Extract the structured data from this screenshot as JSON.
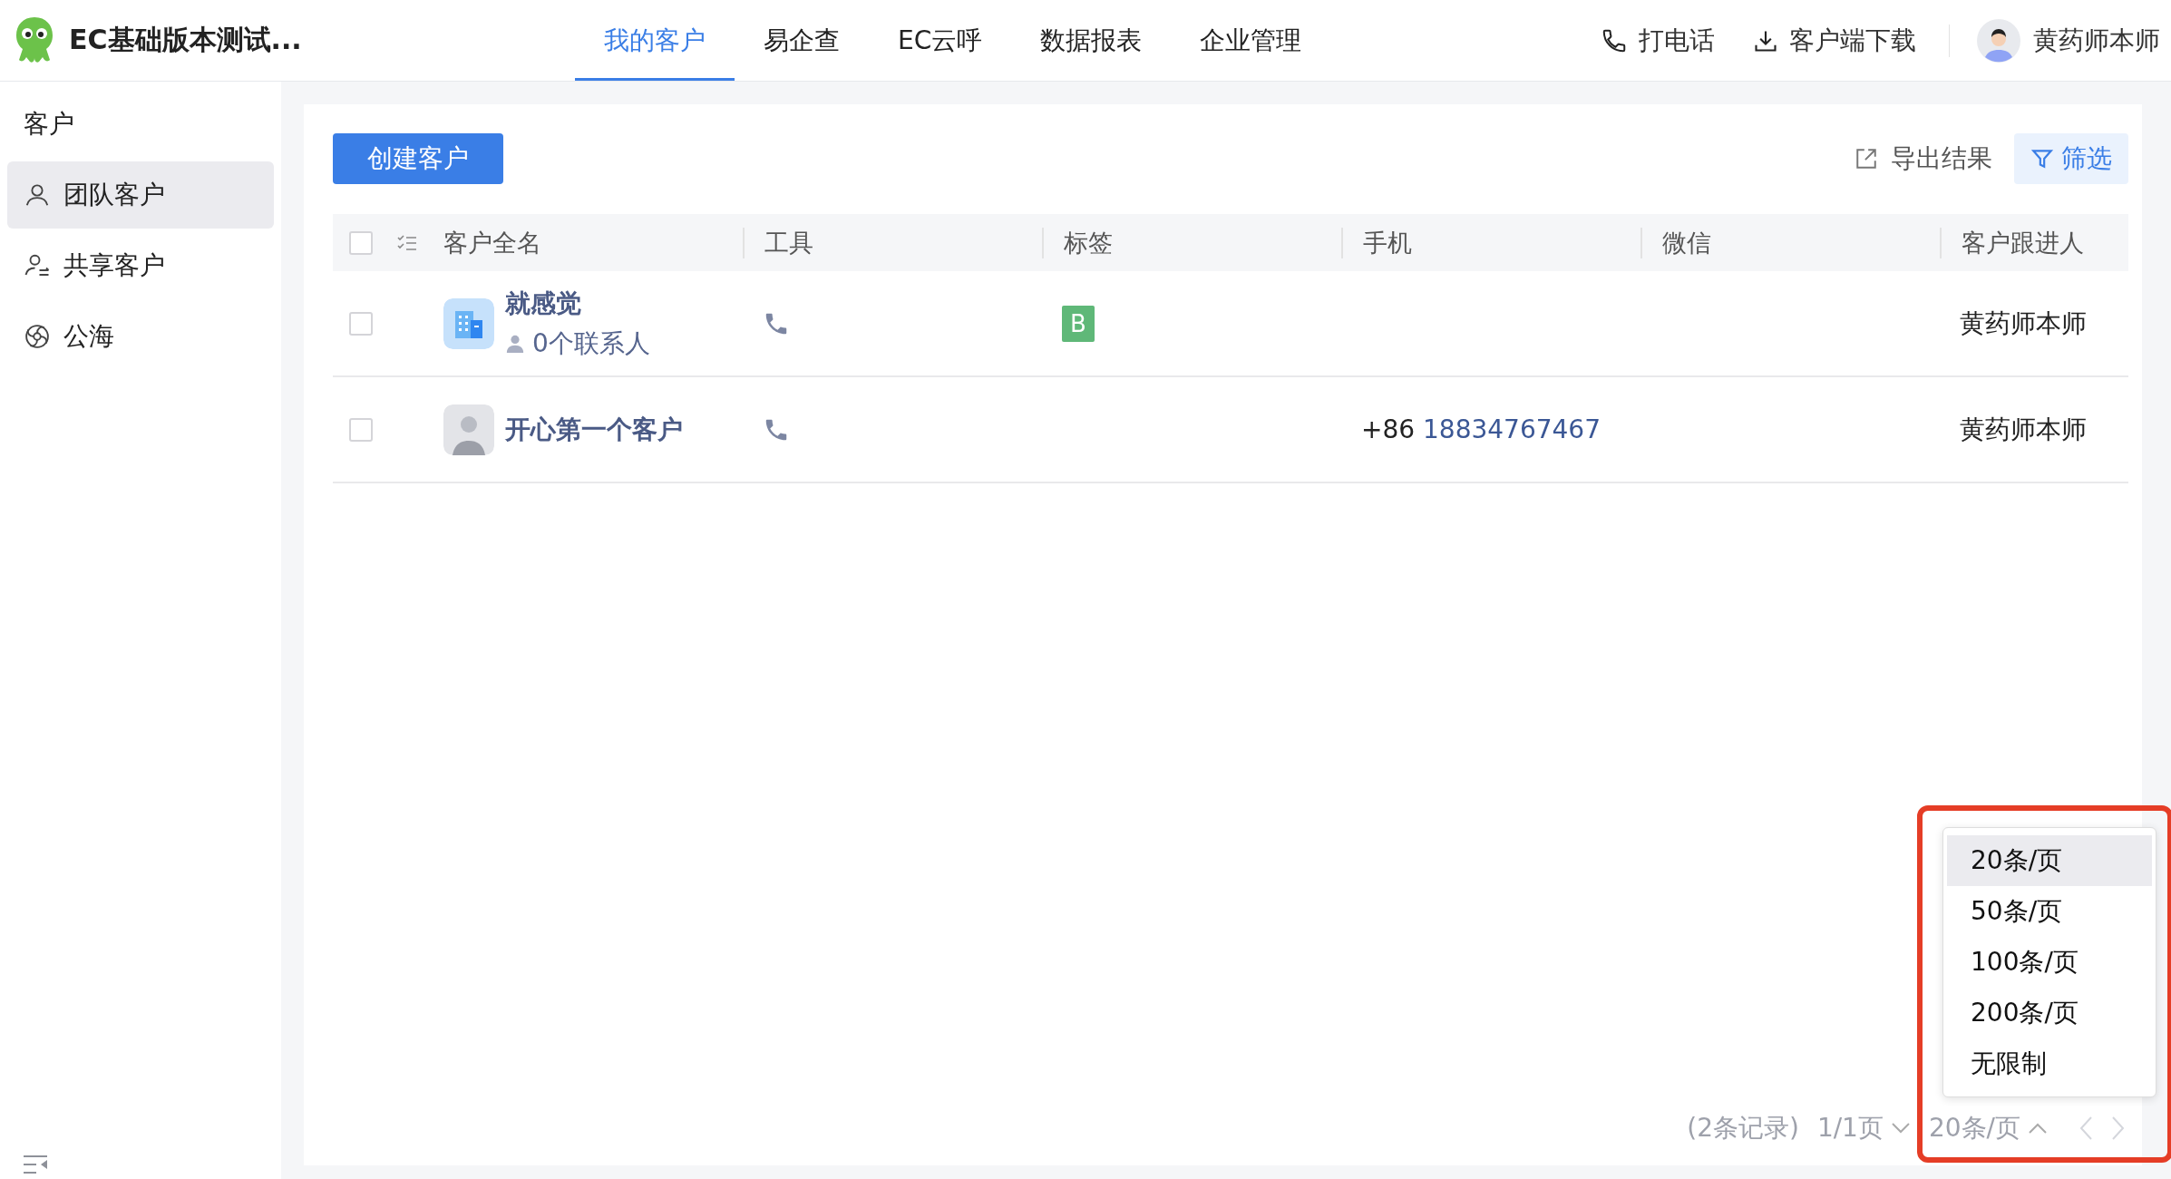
{
  "app": {
    "name": "EC基础版本测试..."
  },
  "nav": {
    "tabs": [
      {
        "label": "我的客户",
        "selected": true
      },
      {
        "label": "易企查",
        "selected": false
      },
      {
        "label": "EC云呼",
        "selected": false
      },
      {
        "label": "数据报表",
        "selected": false
      },
      {
        "label": "企业管理",
        "selected": false
      }
    ]
  },
  "header_actions": [
    {
      "kind": "phone",
      "label": "打电话"
    },
    {
      "kind": "download",
      "label": "客户端下载"
    }
  ],
  "user": {
    "name": "黄药师本师"
  },
  "sidebar": {
    "heading": "客户",
    "items": [
      {
        "kind": "team",
        "label": "团队客户",
        "selected": true
      },
      {
        "kind": "shared",
        "label": "共享客户",
        "selected": false
      },
      {
        "kind": "sea",
        "label": "公海",
        "selected": false
      }
    ]
  },
  "toolbar": {
    "create_button": "创建客户",
    "export_button": "导出结果",
    "filter_button": {
      "label": "筛选",
      "active": true
    }
  },
  "table": {
    "select_all_checked": false,
    "columns": [
      {
        "label": "客户全名"
      },
      {
        "label": "工具"
      },
      {
        "label": "标签"
      },
      {
        "label": "手机"
      },
      {
        "label": "微信"
      },
      {
        "label": "客户跟进人"
      }
    ],
    "rows": [
      {
        "checked": false,
        "kind": "company",
        "name": "就感觉",
        "contacts": "0个联系人",
        "tag": "B",
        "phone_prefix": "",
        "phone": "",
        "follower": "黄药师本师"
      },
      {
        "checked": false,
        "kind": "person",
        "name": "开心第一个客户",
        "tag": "",
        "phone_prefix": "+86",
        "phone": "18834767467",
        "follower": "黄药师本师"
      }
    ]
  },
  "pagination": {
    "records": "(2条记录)",
    "pages": "1/1页",
    "page_size": "20条/页",
    "page_size_open": true
  },
  "page_size_menu": [
    {
      "label": "20条/页",
      "selected": true
    },
    {
      "label": "50条/页",
      "selected": false
    },
    {
      "label": "100条/页",
      "selected": false
    },
    {
      "label": "200条/页",
      "selected": false
    },
    {
      "label": "无限制",
      "selected": false
    }
  ]
}
